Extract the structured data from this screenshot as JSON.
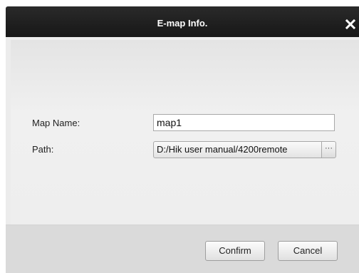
{
  "dialog": {
    "title": "E-map Info.",
    "close_icon": "close-icon"
  },
  "form": {
    "map_name_label": "Map Name:",
    "map_name_value": "map1",
    "path_label": "Path:",
    "path_value": "D:/Hik user manual/4200remote",
    "browse_label": "···"
  },
  "footer": {
    "confirm_label": "Confirm",
    "cancel_label": "Cancel"
  },
  "colors": {
    "titlebar": "#1f1f1f",
    "dialog_bg": "#ececec",
    "footer_bg": "#dadada"
  }
}
